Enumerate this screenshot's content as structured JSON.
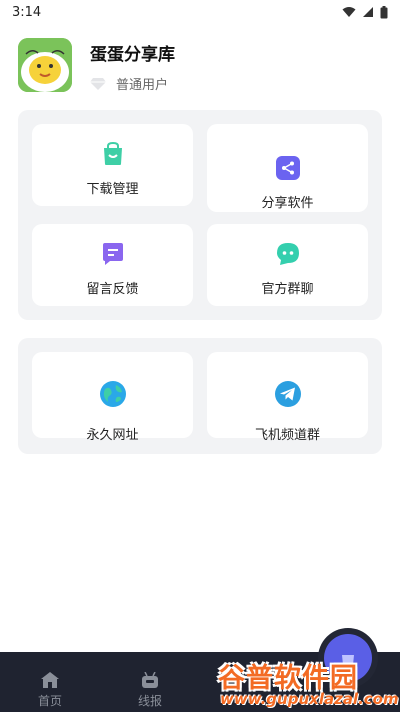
{
  "status_bar": {
    "time": "3:14"
  },
  "profile": {
    "name": "蛋蛋分享库",
    "level": "普通用户"
  },
  "menu_group_1": [
    {
      "label": "下载管理",
      "icon": "shopping-bag-icon",
      "color": "#3ecfa6"
    },
    {
      "label": "分享软件",
      "icon": "share-icon",
      "color": "#6b63f0"
    },
    {
      "label": "留言反馈",
      "icon": "message-icon",
      "color": "#8a66ef"
    },
    {
      "label": "官方群聊",
      "icon": "chat-bubble-icon",
      "color": "#34cfae"
    }
  ],
  "menu_group_2": [
    {
      "label": "永久网址",
      "icon": "globe-icon",
      "color": "#2aa8e8"
    },
    {
      "label": "飞机频道群",
      "icon": "telegram-icon",
      "color": "#2b9fe0"
    }
  ],
  "bottom_nav": [
    {
      "label": "首页",
      "icon": "home-icon"
    },
    {
      "label": "线报",
      "icon": "robot-icon"
    }
  ],
  "watermark": {
    "title": "谷普软件园",
    "url": "www.gupuxlazal.com"
  }
}
